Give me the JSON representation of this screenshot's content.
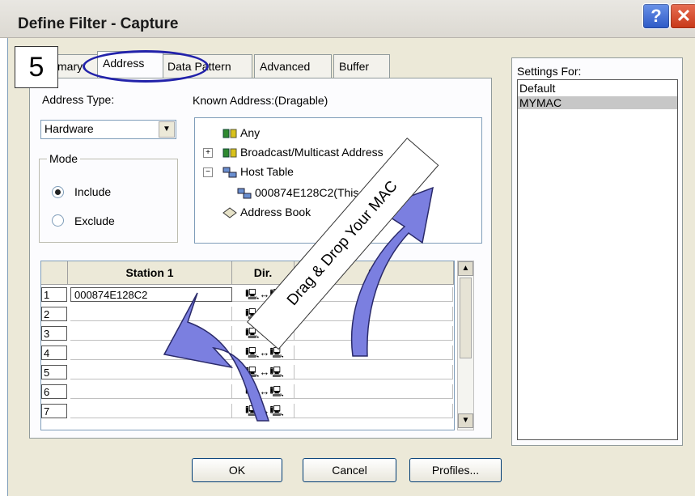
{
  "window": {
    "title": "Define Filter - Capture",
    "help_label": "?",
    "close_label": "✕"
  },
  "annotation": {
    "step_number": "5",
    "banner_text": "Drag & Drop Your MAC"
  },
  "tabs": [
    {
      "label": "Summary",
      "shown_label": "mary"
    },
    {
      "label": "Address",
      "active": true
    },
    {
      "label": "Data Pattern"
    },
    {
      "label": "Advanced"
    },
    {
      "label": "Buffer"
    }
  ],
  "address_type": {
    "label": "Address Type:",
    "value": "Hardware"
  },
  "mode": {
    "title": "Mode",
    "options": [
      {
        "label": "Include",
        "selected": true
      },
      {
        "label": "Exclude",
        "selected": false
      }
    ]
  },
  "known_address": {
    "label": "Known Address:(Dragable)",
    "items": [
      {
        "label": "Any",
        "icon": "network-icon",
        "level": 0
      },
      {
        "label": "Broadcast/Multicast Address",
        "icon": "network-icon",
        "level": 0,
        "expander": "+"
      },
      {
        "label": "Host Table",
        "icon": "host-table-icon",
        "level": 0,
        "expander": "−"
      },
      {
        "label": "000874E128C2(This station)",
        "icon": "host-table-icon",
        "level": 1
      },
      {
        "label": "Address Book",
        "icon": "address-book-icon",
        "level": 0
      }
    ]
  },
  "station_grid": {
    "columns": [
      "",
      "Station 1",
      "Dir.",
      "St"
    ],
    "direction_glyph": "🖳↔🖳",
    "rows": [
      {
        "num": "1",
        "station1": "000874E128C2"
      },
      {
        "num": "2",
        "station1": ""
      },
      {
        "num": "3",
        "station1": ""
      },
      {
        "num": "4",
        "station1": ""
      },
      {
        "num": "5",
        "station1": ""
      },
      {
        "num": "6",
        "station1": ""
      },
      {
        "num": "7",
        "station1": ""
      }
    ]
  },
  "settings_for": {
    "label": "Settings For:",
    "items": [
      "Default",
      "MYMAC"
    ],
    "selected": "MYMAC"
  },
  "buttons": {
    "ok": "OK",
    "cancel": "Cancel",
    "profiles": "Profiles..."
  }
}
